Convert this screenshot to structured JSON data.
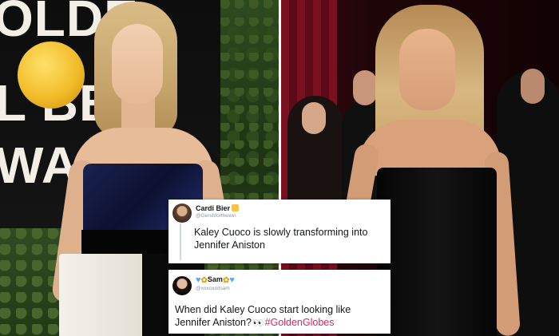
{
  "backdrop": {
    "line1": "OLDE",
    "line2": "L  BE",
    "line3": "WAR"
  },
  "tweets": [
    {
      "name": "Cardi Bier",
      "name_suffix_icon": "yellow-square-emoji",
      "handle": "@Gershforthewin",
      "text": "Kaley Cuoco is slowly transforming into Jennifer Aniston"
    },
    {
      "name_prefix_icons": [
        "blue-heart-emoji",
        "sunflower-emoji"
      ],
      "name": "Sam",
      "name_suffix_icons": [
        "sunflower-emoji",
        "blue-heart-emoji"
      ],
      "handle": "@xoxoxoitsam",
      "text": "When did Kaley Cuoco start looking like Jennifer Aniston?",
      "emoji": "eyes-emoji",
      "hashtag": "#GoldenGlobes"
    }
  ],
  "colors": {
    "hashtag": "#e0245e",
    "gold_frame": "#c9a230",
    "heart": "#55acee"
  }
}
